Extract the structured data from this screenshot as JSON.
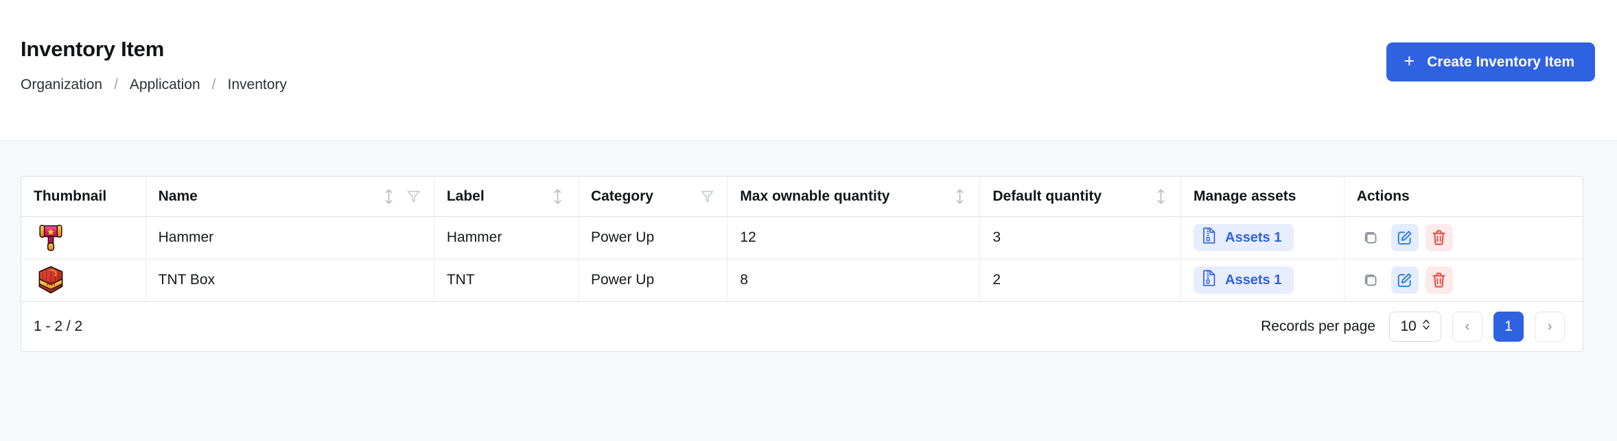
{
  "header": {
    "title": "Inventory Item",
    "breadcrumb": [
      "Organization",
      "Application",
      "Inventory"
    ],
    "breadcrumb_separator": "/",
    "create_button": {
      "label": "Create Inventory Item",
      "icon": "plus-icon"
    }
  },
  "table": {
    "columns": [
      {
        "label": "Thumbnail",
        "sortable": false,
        "filterable": false
      },
      {
        "label": "Name",
        "sortable": true,
        "filterable": true
      },
      {
        "label": "Label",
        "sortable": true,
        "filterable": false
      },
      {
        "label": "Category",
        "sortable": false,
        "filterable": true
      },
      {
        "label": "Max ownable quantity",
        "sortable": true,
        "filterable": false
      },
      {
        "label": "Default quantity",
        "sortable": true,
        "filterable": false
      },
      {
        "label": "Manage assets",
        "sortable": false,
        "filterable": false
      },
      {
        "label": "Actions",
        "sortable": false,
        "filterable": false
      }
    ],
    "rows": [
      {
        "thumbnail": "hammer-thumbnail",
        "name": "Hammer",
        "label": "Hammer",
        "category": "Power Up",
        "max_ownable_quantity": "12",
        "default_quantity": "3",
        "assets": "Assets 1"
      },
      {
        "thumbnail": "tnt-box-thumbnail",
        "name": "TNT Box",
        "label": "TNT",
        "category": "Power Up",
        "max_ownable_quantity": "8",
        "default_quantity": "2",
        "assets": "Assets 1"
      }
    ],
    "row_actions": [
      {
        "name": "duplicate",
        "icon": "copy-icon"
      },
      {
        "name": "edit",
        "icon": "edit-pencil-icon"
      },
      {
        "name": "delete",
        "icon": "trash-icon"
      }
    ]
  },
  "footer": {
    "record_range": "1 - 2 / 2",
    "records_per_page_label": "Records per page",
    "records_per_page_value": "10",
    "prev_label": "‹",
    "next_label": "›",
    "pages": [
      "1"
    ],
    "current_page": "1"
  },
  "colors": {
    "accent": "#2f62e0",
    "page_bg": "#f6f8fa",
    "danger": "#e8453c",
    "chip_bg": "#e8eeff"
  }
}
